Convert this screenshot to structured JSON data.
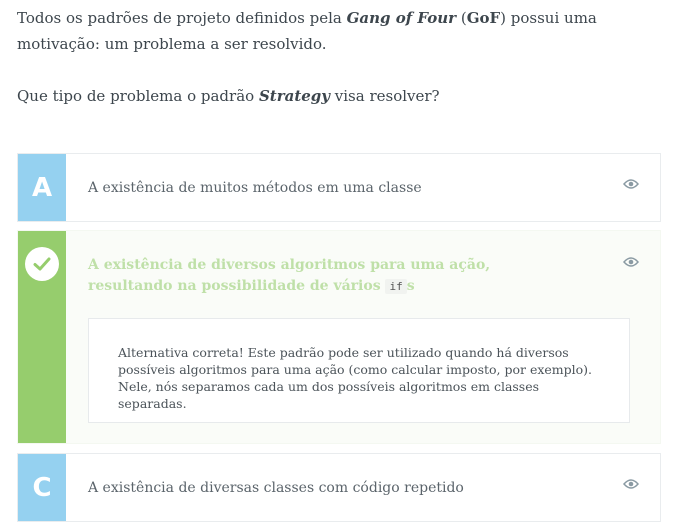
{
  "question": {
    "line1_pre": "Todos os padrões de projeto definidos pela ",
    "line1_em": "Gang of Four",
    "line1_mid": " (",
    "line1_strong": "GoF",
    "line1_post": ") possui uma motivação: um problema a ser resolvido.",
    "line2_pre": "Que tipo de problema o padrão ",
    "line2_em": "Strategy",
    "line2_post": " visa resolver?"
  },
  "options": [
    {
      "letter": "A",
      "text": "A existência de muitos métodos em uma classe",
      "icon": "eye-icon"
    },
    {
      "state": "correct",
      "icon_left": "check-icon",
      "text_pre": "A existência de diversos algoritmos para uma ação, resultando na possibilidade de vários ",
      "code": "if",
      "text_post": "s",
      "icon": "eye-icon",
      "explanation": "Alternativa correta! Este padrão pode ser utilizado quando há diversos possíveis algoritmos para uma ação (como calcular imposto, por exemplo). Nele, nós separamos cada um dos possíveis algoritmos em classes separadas."
    },
    {
      "letter": "C",
      "text": "A existência de diversas classes com código repetido",
      "icon": "eye-icon"
    }
  ],
  "colors": {
    "letter_bg": "#95d1f0",
    "correct_bar": "#96cd6d",
    "correct_text": "#bfe0a8",
    "eye": "#8a9aa3"
  }
}
